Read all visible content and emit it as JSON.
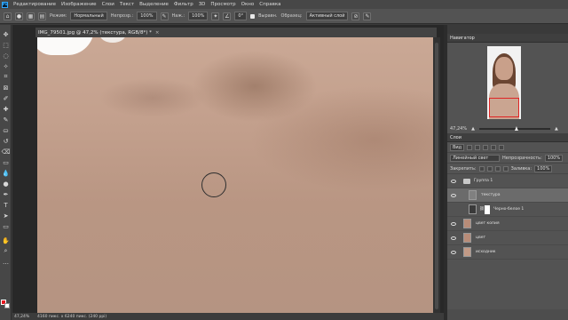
{
  "menubar": {
    "logo": "Ps",
    "items": [
      "Редактирование",
      "Изображение",
      "Слои",
      "Текст",
      "Выделение",
      "Фильтр",
      "3D",
      "Просмотр",
      "Окно",
      "Справка"
    ]
  },
  "options": {
    "mode_label": "Режим:",
    "mode_value": "Нормальный",
    "opacity_label": "Непрозр.:",
    "opacity_value": "100%",
    "flow_label": "Наж.:",
    "flow_value": "100%",
    "angle_value": "0°",
    "align_label": "Выравн.",
    "sample_label": "Образец:",
    "sample_value": "Активный слой"
  },
  "document": {
    "tab_title": "IMG_79501.jpg @ 47,2% (текстура, RGB/8*) *",
    "status_zoom": "47,24%",
    "status_info": "4160 пикс. x 6240 пикс. (240 ppi)"
  },
  "navigator": {
    "title": "Навигатор",
    "zoom": "47,24%"
  },
  "layers": {
    "title": "Слои",
    "filter_value": "Вид",
    "blend_value": "Линейный свет",
    "opacity_label": "Непрозрачность:",
    "opacity_value": "100%",
    "lock_label": "Закрепить:",
    "fill_label": "Заливка:",
    "fill_value": "100%",
    "items": [
      {
        "name": "Группа 1"
      },
      {
        "name": "текстура"
      },
      {
        "name": "Черно-белое 1"
      },
      {
        "name": "цвет копия"
      },
      {
        "name": "цвет"
      },
      {
        "name": "исходник"
      }
    ]
  },
  "colors": {
    "foreground": "#e8171f",
    "background": "#ffffff"
  }
}
